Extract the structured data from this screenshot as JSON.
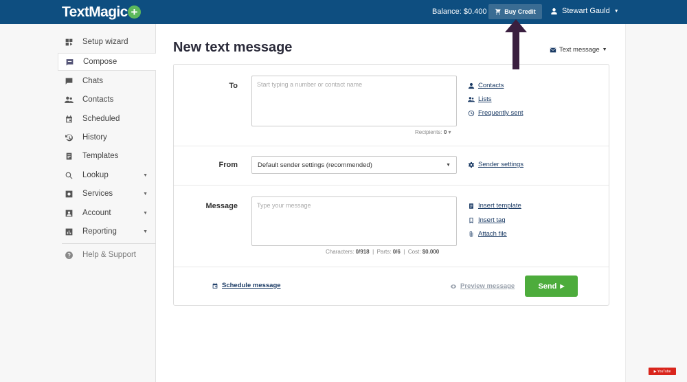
{
  "header": {
    "logo": "TextMagic",
    "logo_plus": "+",
    "balance": "Balance: $0.400",
    "buy_credit": "Buy Credit",
    "user_name": "Stewart Gauld"
  },
  "sidebar": {
    "items": [
      {
        "label": "Setup wizard",
        "icon": "setup-wizard-icon"
      },
      {
        "label": "Compose",
        "icon": "compose-icon"
      },
      {
        "label": "Chats",
        "icon": "chats-icon"
      },
      {
        "label": "Contacts",
        "icon": "contacts-icon"
      },
      {
        "label": "Scheduled",
        "icon": "calendar-icon"
      },
      {
        "label": "History",
        "icon": "history-icon"
      },
      {
        "label": "Templates",
        "icon": "templates-icon"
      },
      {
        "label": "Lookup",
        "icon": "search-icon"
      },
      {
        "label": "Services",
        "icon": "services-icon"
      },
      {
        "label": "Account",
        "icon": "account-icon"
      },
      {
        "label": "Reporting",
        "icon": "reporting-icon"
      },
      {
        "label": "Help & Support",
        "icon": "help-icon"
      }
    ]
  },
  "main": {
    "title": "New text message",
    "message_type": "Text message",
    "to": {
      "label": "To",
      "placeholder": "Start typing a number or contact name",
      "recipients_label": "Recipients:",
      "recipients_count": "0",
      "links": [
        "Contacts",
        "Lists",
        "Frequently sent"
      ]
    },
    "from": {
      "label": "From",
      "selected": "Default sender settings (recommended)",
      "link": "Sender settings"
    },
    "message": {
      "label": "Message",
      "placeholder": "Type your message",
      "characters_label": "Characters:",
      "characters": "0/918",
      "parts_label": "Parts:",
      "parts": "0/6",
      "cost_label": "Cost:",
      "cost": "$0.000",
      "links": [
        "Insert template",
        "Insert tag",
        "Attach file"
      ]
    },
    "footer": {
      "schedule": "Schedule message",
      "preview": "Preview message",
      "send": "Send"
    }
  },
  "colors": {
    "topbar": "#0e4e80",
    "accent_green": "#4dac3c",
    "link": "#1b3b65",
    "annotation_arrow": "#3a1f3f"
  }
}
